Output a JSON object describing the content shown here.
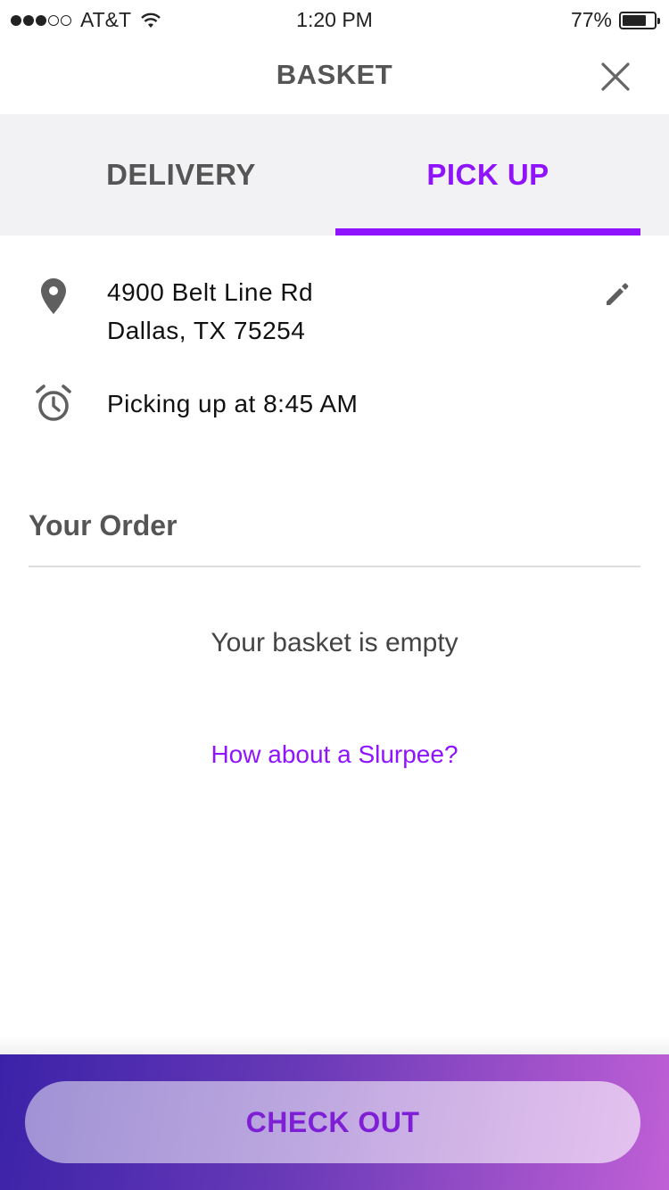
{
  "status_bar": {
    "carrier": "AT&T",
    "time": "1:20 PM",
    "battery_percent": "77%",
    "battery_level": 0.77,
    "signal_bars_filled": 3,
    "signal_bars_total": 5
  },
  "header": {
    "title": "BASKET",
    "close_icon": "close-icon"
  },
  "tabs": [
    {
      "label": "DELIVERY",
      "selected": false
    },
    {
      "label": "PICK UP",
      "selected": true
    }
  ],
  "pickup": {
    "address_line1": "4900 Belt Line Rd",
    "address_line2": "Dallas, TX 75254",
    "pickup_time_text": "Picking up at 8:45 AM",
    "location_icon": "location-pin-icon",
    "alarm_icon": "alarm-clock-icon",
    "edit_icon": "pencil-icon"
  },
  "order": {
    "section_title": "Your Order",
    "empty_message": "Your basket is empty",
    "suggestion_link": "How about a Slurpee?"
  },
  "footer": {
    "checkout_label": "CHECK OUT"
  },
  "colors": {
    "accent": "#9013fe",
    "tab_background": "#f2f2f4",
    "heading_gray": "#555555",
    "footer_gradient_start": "#3a22a8",
    "footer_gradient_end": "#c060d6"
  }
}
